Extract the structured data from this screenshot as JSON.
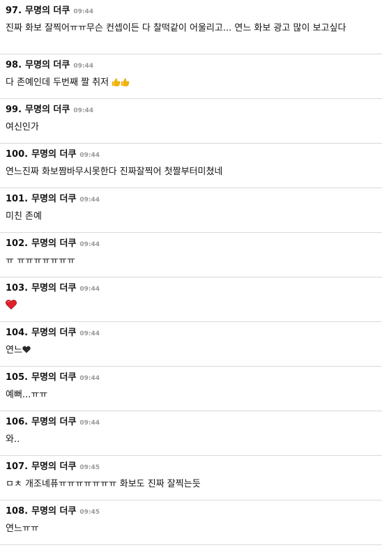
{
  "comments": [
    {
      "num": "97.",
      "author": "무명의 더쿠",
      "time": "09:44",
      "text": "진짜 화보 잘찍어ㅠㅠ무슨 컨셉이든 다 찰떡같이 어울리고... 연느 화보 광고 많이 보고싶다"
    },
    {
      "num": "98.",
      "author": "무명의 더쿠",
      "time": "09:44",
      "text": "다 존예인데 두번째 짤 취저",
      "emoji": [
        "thumbs-up",
        "thumbs-up"
      ]
    },
    {
      "num": "99.",
      "author": "무명의 더쿠",
      "time": "09:44",
      "text": "여신인가"
    },
    {
      "num": "100.",
      "author": "무명의 더쿠",
      "time": "09:44",
      "text": "연느진짜 화보짬바무시못한다 진짜잘찍어 첫짤부터미쳤네"
    },
    {
      "num": "101.",
      "author": "무명의 더쿠",
      "time": "09:44",
      "text": "미친 존예"
    },
    {
      "num": "102.",
      "author": "무명의 더쿠",
      "time": "09:44",
      "text": "ㅠ ㅠㅠㅠㅠㅠㅠㅠ"
    },
    {
      "num": "103.",
      "author": "무명의 더쿠",
      "time": "09:44",
      "text": "",
      "emoji": [
        "red-heart"
      ]
    },
    {
      "num": "104.",
      "author": "무명의 더쿠",
      "time": "09:44",
      "text": "연느",
      "emoji": [
        "black-heart"
      ]
    },
    {
      "num": "105.",
      "author": "무명의 더쿠",
      "time": "09:44",
      "text": "예뻐...ㅠㅠ"
    },
    {
      "num": "106.",
      "author": "무명의 더쿠",
      "time": "09:44",
      "text": "와.."
    },
    {
      "num": "107.",
      "author": "무명의 더쿠",
      "time": "09:45",
      "text": "ㅁㅊ 개조녜퓨ㅠㅠㅠㅠㅠㅠㅠ 화보도 진짜 잘찍는듯"
    },
    {
      "num": "108.",
      "author": "무명의 더쿠",
      "time": "09:45",
      "text": "연느ㅠㅠ"
    }
  ],
  "colors": {
    "divider": "#d9d9d9",
    "time": "#999999",
    "text": "#111111",
    "heart_red": "#e0202a",
    "heart_black": "#2a2a2a",
    "thumb": "#f4b400"
  }
}
